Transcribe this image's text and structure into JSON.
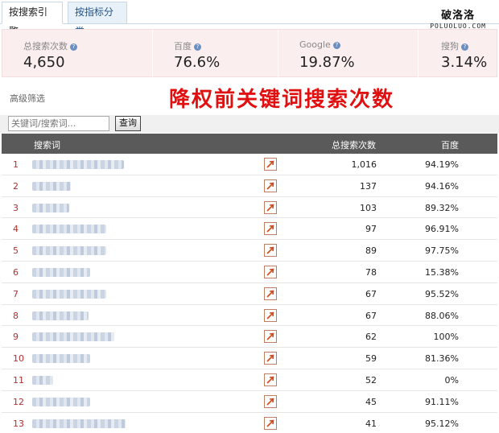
{
  "tabs": [
    {
      "label": "按搜索引擎",
      "active": true
    },
    {
      "label": "按指标分类",
      "active": false
    }
  ],
  "watermark": {
    "cn": "破洛洛",
    "en": "POLUOLUO.COM"
  },
  "stats": [
    {
      "label": "总搜索次数",
      "value": "4,650"
    },
    {
      "label": "百度",
      "value": "76.6%"
    },
    {
      "label": "Google",
      "value": "19.87%"
    },
    {
      "label": "搜狗",
      "value": "3.14%"
    }
  ],
  "filter": {
    "advanced_label": "高级筛选"
  },
  "headline": "降权前关键词搜索次数",
  "search": {
    "placeholder": "关键词/搜索词...",
    "button_label": "查询"
  },
  "table": {
    "headers": {
      "term": "搜索词",
      "total": "总搜索次数",
      "baidu": "百度"
    },
    "rows": [
      {
        "rank": "1",
        "total": "1,016",
        "baidu": "94.19%",
        "blur_width": 114
      },
      {
        "rank": "2",
        "total": "137",
        "baidu": "94.16%",
        "blur_width": 48
      },
      {
        "rank": "3",
        "total": "103",
        "baidu": "89.32%",
        "blur_width": 46
      },
      {
        "rank": "4",
        "total": "97",
        "baidu": "96.91%",
        "blur_width": 92
      },
      {
        "rank": "5",
        "total": "89",
        "baidu": "97.75%",
        "blur_width": 92
      },
      {
        "rank": "6",
        "total": "78",
        "baidu": "15.38%",
        "blur_width": 72
      },
      {
        "rank": "7",
        "total": "67",
        "baidu": "95.52%",
        "blur_width": 92
      },
      {
        "rank": "8",
        "total": "67",
        "baidu": "88.06%",
        "blur_width": 70
      },
      {
        "rank": "9",
        "total": "62",
        "baidu": "100%",
        "blur_width": 102
      },
      {
        "rank": "10",
        "total": "59",
        "baidu": "81.36%",
        "blur_width": 72
      },
      {
        "rank": "11",
        "total": "52",
        "baidu": "0%",
        "blur_width": 26
      },
      {
        "rank": "12",
        "total": "45",
        "baidu": "91.11%",
        "blur_width": 72
      },
      {
        "rank": "13",
        "total": "41",
        "baidu": "95.12%",
        "blur_width": 116
      }
    ]
  },
  "colors": {
    "headline": "#e01010",
    "rank": "#b03030",
    "header_bg": "#5a5a5a",
    "stats_bg": "#fbeeee"
  },
  "icons": {
    "trend": "trend-arrow-icon",
    "help": "question-icon"
  }
}
